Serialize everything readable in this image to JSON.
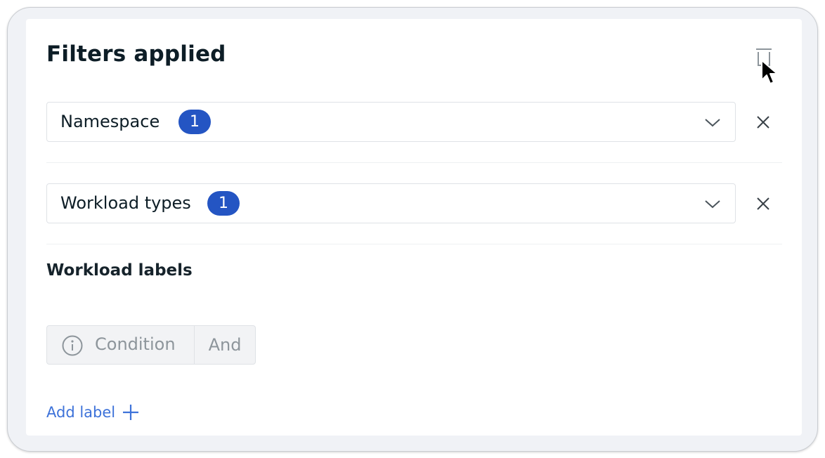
{
  "panel": {
    "title": "Filters applied"
  },
  "filters": [
    {
      "label": "Namespace",
      "count": "1"
    },
    {
      "label": "Workload types",
      "count": "1"
    }
  ],
  "labels_section": {
    "heading": "Workload labels",
    "condition_label": "Condition",
    "operator": "And",
    "add_label": "Add label"
  },
  "colors": {
    "badge": "#2455c3",
    "link": "#3d72d9",
    "text": "#0d1d26",
    "muted": "#8d959b"
  },
  "icons": [
    "trash-icon",
    "chevron-down-icon",
    "close-icon",
    "info-icon",
    "plus-icon",
    "mouse-cursor-icon"
  ]
}
